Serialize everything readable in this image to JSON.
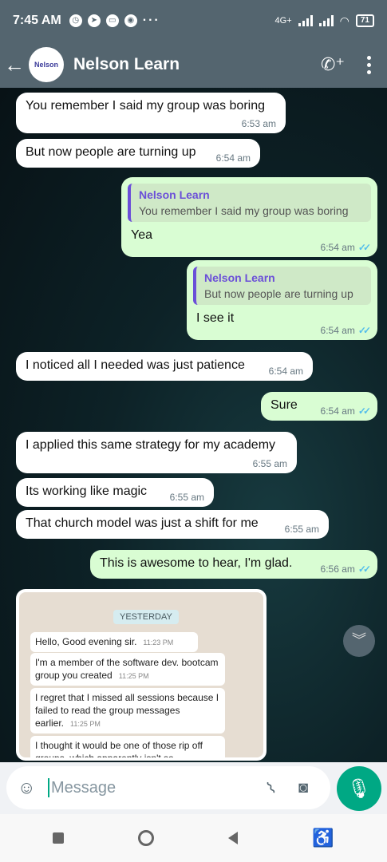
{
  "status_bar": {
    "time": "7:45 AM",
    "network": "4G+",
    "battery": "71"
  },
  "header": {
    "back_icon": "arrow-left-icon",
    "avatar_text": "Nelson",
    "title": "Nelson Learn",
    "call_icon": "add-call-icon",
    "menu_icon": "kebab-icon"
  },
  "messages": [
    {
      "text": "You remember I said my group was boring",
      "time": "6:53 am"
    },
    {
      "text": "But now people are turning up",
      "time": "6:54 am"
    },
    {
      "quote_name": "Nelson Learn",
      "quote_text": "You remember I said my group was boring",
      "text": "Yea",
      "time": "6:54 am"
    },
    {
      "quote_name": "Nelson Learn",
      "quote_text": "But now people are turning up",
      "text": "I see it",
      "time": "6:54 am"
    },
    {
      "text": "I noticed all I needed was just patience",
      "time": "6:54 am"
    },
    {
      "text": "Sure",
      "time": "6:54 am"
    },
    {
      "text": "I applied this same strategy for my academy",
      "time": "6:55 am"
    },
    {
      "text": "Its working like magic",
      "time": "6:55 am"
    },
    {
      "text": "That church model was just a shift for me",
      "time": "6:55 am"
    },
    {
      "text": "This is awesome to hear, I'm glad.",
      "time": "6:56 am"
    }
  ],
  "ticks": "✓✓",
  "media": {
    "date_label": "YESTERDAY",
    "items": [
      {
        "text": "Hello, Good evening sir.",
        "time": "11:23 PM"
      },
      {
        "text": "I'm a member of the software dev. bootcam group you created",
        "time": "11:25 PM"
      },
      {
        "text": "I regret that I missed all sessions because I failed to read the group messages earlier.",
        "time": "11:25 PM"
      },
      {
        "text": "I thought it would be one of those rip off groups, which apparently isn't so.",
        "time": ""
      }
    ]
  },
  "composer": {
    "placeholder": "Message",
    "emoji_icon": "emoji-icon",
    "attach_icon": "paperclip-icon",
    "camera_icon": "camera-icon",
    "mic_icon": "mic-icon"
  }
}
